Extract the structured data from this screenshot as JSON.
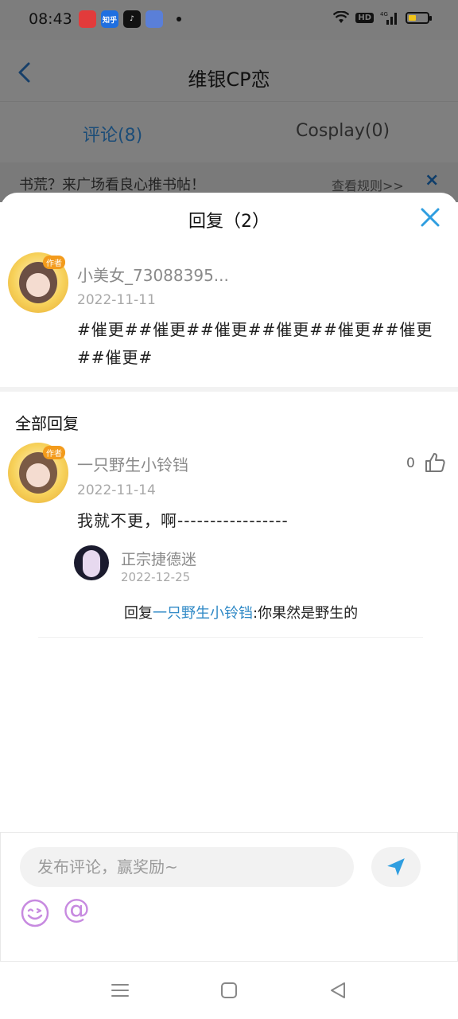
{
  "status_bar": {
    "time": "08:43",
    "hd": "HD",
    "network": "4G",
    "app_icons": [
      "app1",
      "知乎",
      "tiktok",
      "app4"
    ]
  },
  "nav": {
    "title": "维银CP恋"
  },
  "tabs": [
    {
      "label": "评论(8)"
    },
    {
      "label": "Cosplay(0)"
    }
  ],
  "notice": {
    "text": "书荒？来广场看良心推书帖！",
    "rule": "查看规则>>",
    "close": "×"
  },
  "sheet": {
    "title": "回复（2）",
    "main_comment": {
      "badge": "作者",
      "name": "小美女_73088395...",
      "date": "2022-11-11",
      "content": "#催更##催更##催更##催更##催更##催更##催更#"
    },
    "section_title": "全部回复",
    "reply": {
      "badge": "作者",
      "name": "一只野生小铃铛",
      "date": "2022-11-14",
      "content": "我就不更，啊-----------------",
      "likes": "0",
      "sub_reply": {
        "name": "正宗捷德迷",
        "date": "2022-12-25",
        "prefix": "回复",
        "target": "一只野生小铃铛",
        "text": ":你果然是野生的"
      }
    }
  },
  "input": {
    "placeholder": "发布评论，赢奖励~",
    "at_symbol": "@"
  },
  "colors": {
    "accent": "#2f89c6",
    "close_blue": "#2f9ee0",
    "emoji_purple": "#c78ae0"
  }
}
